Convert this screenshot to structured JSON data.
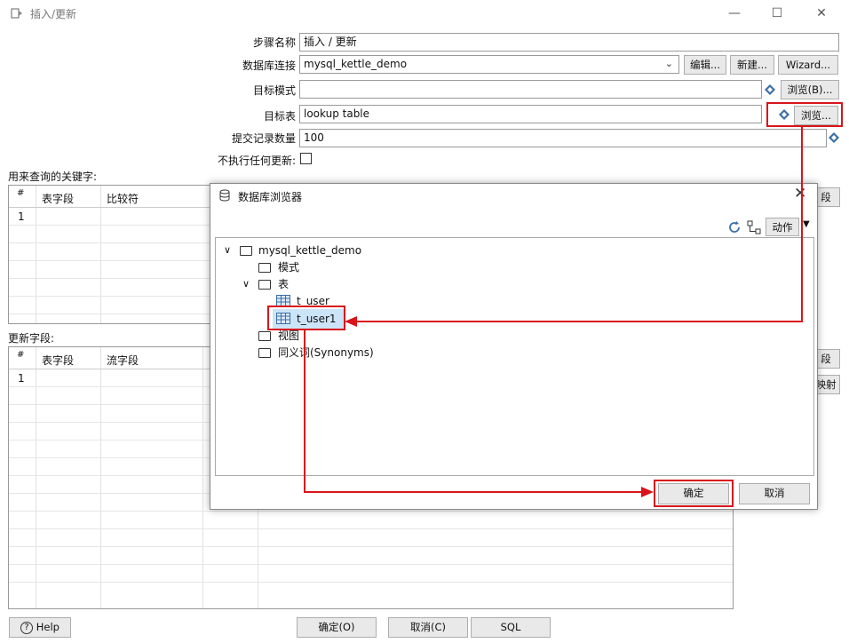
{
  "window": {
    "title": "插入/更新",
    "controls": [
      "—",
      "☐",
      "✕"
    ]
  },
  "form": {
    "step_name_label": "步骤名称",
    "step_name_value": "插入 / 更新",
    "db_conn_label": "数据库连接",
    "db_conn_value": "mysql_kettle_demo",
    "edit_btn": "编辑...",
    "new_btn": "新建...",
    "wizard_btn": "Wizard...",
    "target_schema_label": "目标模式",
    "target_schema_value": "",
    "browse_b_btn": "浏览(B)...",
    "target_table_label": "目标表",
    "target_table_value": "lookup table",
    "browse_btn": "浏览...",
    "commit_label": "提交记录数量",
    "commit_value": "100",
    "no_update_label": "不执行任何更新:"
  },
  "keys_section": {
    "label": "用来查询的关键字:",
    "columns": [
      "#",
      "表字段",
      "比较符"
    ],
    "first_row": "1",
    "side_btn": "段"
  },
  "update_section": {
    "label": "更新字段:",
    "columns": [
      "#",
      "表字段",
      "流字段"
    ],
    "first_row": "1",
    "side_btn1": "段",
    "side_btn2": "映射"
  },
  "bottom": {
    "help": "Help",
    "ok": "确定(O)",
    "cancel": "取消(C)",
    "sql": "SQL"
  },
  "dialog": {
    "title": "数据库浏览器",
    "action_btn": "动作",
    "tree": {
      "root": "mysql_kettle_demo",
      "schemas": "模式",
      "tables": "表",
      "table1": "t_user",
      "table2": "t_user1",
      "views": "视图",
      "synonyms": "同义词(Synonyms)"
    },
    "ok": "确定",
    "cancel": "取消"
  },
  "colors": {
    "highlight": "#d9141b",
    "selection": "#cce4f7"
  }
}
